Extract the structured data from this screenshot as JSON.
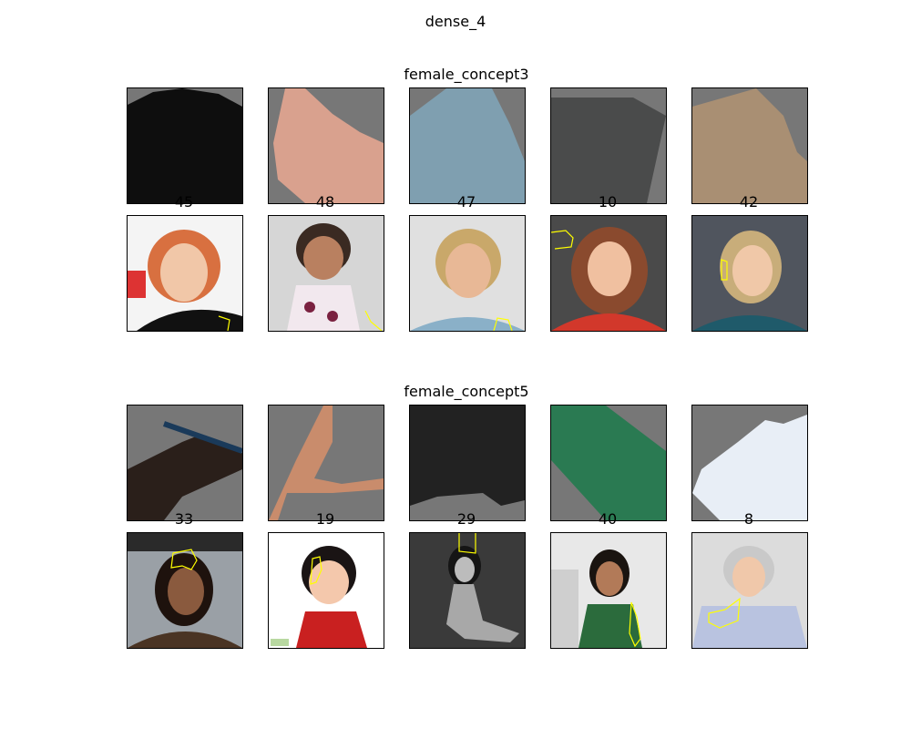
{
  "figure_title": "dense_4",
  "groups": [
    {
      "title": "female_concept3",
      "patches": [
        {
          "icon": "dark-fabric-patch-icon",
          "color": "#0e0e0e"
        },
        {
          "icon": "skin-patch-icon",
          "color": "#d9a18e"
        },
        {
          "icon": "blue-patch-icon",
          "color": "#7f9fb0"
        },
        {
          "icon": "gray-patch-icon",
          "color": "#4a4b4b"
        },
        {
          "icon": "tan-patch-icon",
          "color": "#a98f73"
        }
      ],
      "images": [
        {
          "label": "45",
          "icon": "portrait-red-hair-icon",
          "desc_color": "#d87040"
        },
        {
          "label": "48",
          "icon": "portrait-child-icon",
          "desc_color": "#3a2a22"
        },
        {
          "label": "47",
          "icon": "portrait-blonde-icon",
          "desc_color": "#c9a86a"
        },
        {
          "label": "10",
          "icon": "portrait-auburn-hair-icon",
          "desc_color": "#8a4a2e"
        },
        {
          "label": "42",
          "icon": "portrait-blonde-teal-icon",
          "desc_color": "#c8ad7a"
        }
      ]
    },
    {
      "title": "female_concept5",
      "patches": [
        {
          "icon": "dark-hair-patch-icon",
          "color": "#2a1f1a"
        },
        {
          "icon": "skin-patch-icon",
          "color": "#c98c6c"
        },
        {
          "icon": "black-patch-icon",
          "color": "#222222"
        },
        {
          "icon": "green-patch-icon",
          "color": "#2a7a52"
        },
        {
          "icon": "white-patch-icon",
          "color": "#e8eef6"
        }
      ],
      "images": [
        {
          "label": "33",
          "icon": "portrait-car-selfie-icon",
          "desc_color": "#4a3424"
        },
        {
          "label": "19",
          "icon": "portrait-toddler-icon",
          "desc_color": "#c92020"
        },
        {
          "label": "29",
          "icon": "portrait-bw-icon",
          "desc_color": "#555555"
        },
        {
          "label": "40",
          "icon": "portrait-kitchen-icon",
          "desc_color": "#2b6b3c"
        },
        {
          "label": "8",
          "icon": "portrait-gray-hair-icon",
          "desc_color": "#b9c3e0"
        }
      ]
    }
  ]
}
